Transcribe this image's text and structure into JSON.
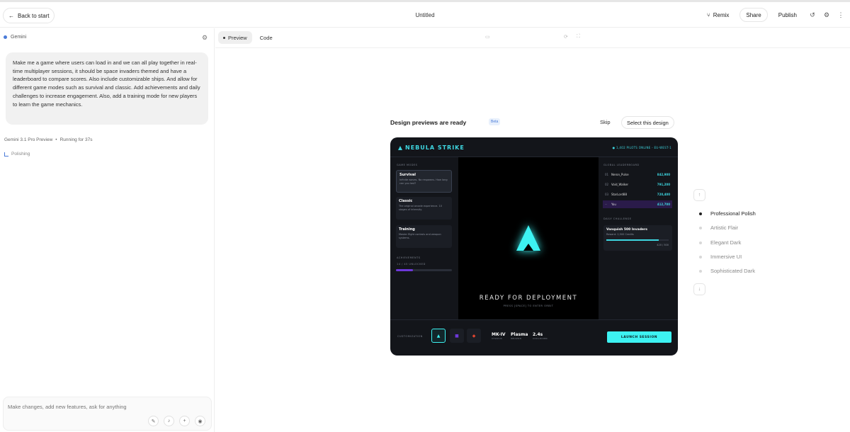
{
  "topbar": {
    "back_label": "Back to start",
    "title": "Untitled",
    "remix_label": "Remix",
    "share_label": "Share",
    "publish_label": "Publish"
  },
  "chat": {
    "model_label": "Gemini",
    "prompt": "Make me a game where users can load in and we can all play together in real-time multiplayer sessions, it should be space invaders themed and have a leaderboard to compare scores. Also include customizable ships. And allow for different game modes such as survival and classic. Add achievements and daily challenges to increase engagement. Also, add a training mode for new players to learn the game mechanics.",
    "model_name": "Gemini 3.1 Pro Preview",
    "separator": "•",
    "running": "Running for 37s",
    "polishing": "Polishing",
    "composer_placeholder": "Make changes, add new features, ask for anything"
  },
  "preview": {
    "tab_preview": "Preview",
    "tab_code": "Code",
    "ready_text": "Design previews are ready",
    "beta": "Beta",
    "skip": "Skip",
    "select": "Select this design"
  },
  "game": {
    "logo": "NEBULA STRIKE",
    "online": "● 1,402 PILOTS ONLINE - EU-WEST-1",
    "game_modes_label": "GAME MODES",
    "modes": [
      {
        "title": "Survival",
        "desc": "Infinite waves. No respawns. How long can you last?"
      },
      {
        "title": "Classic",
        "desc": "The original arcade experience. 10 stages of intensity."
      },
      {
        "title": "Training",
        "desc": "Master flight controls and weapon systems."
      }
    ],
    "achievements_label": "ACHIEVEMENTS",
    "achievements_count": "14 / 45 UNLOCKED",
    "achievements_progress": 0.31,
    "ready": "READY FOR DEPLOYMENT",
    "press": "PRESS [SPACE] TO ENTER ORBIT",
    "leaderboard_label": "GLOBAL LEADERBOARD",
    "leaderboard": [
      {
        "rank": "01",
        "name": "Neron_Pulse",
        "score": "842,900"
      },
      {
        "rank": "02",
        "name": "Void_Walker",
        "score": "791,200"
      },
      {
        "rank": "03",
        "name": "StarLord88",
        "score": "720,400"
      },
      {
        "rank": "--",
        "name": "You",
        "score": "412,700"
      }
    ],
    "daily_label": "DAILY CHALLENGE",
    "daily_title": "Vanquish 500 Invaders",
    "daily_desc": "Reward: 2,500 Credits",
    "daily_count": "420 / 500",
    "daily_progress": 0.84,
    "customization_label": "CUSTOMIZATION",
    "specs": [
      {
        "value": "MK-IV",
        "label": "CHASSIS"
      },
      {
        "value": "Plasma",
        "label": "WEAPON"
      },
      {
        "value": "2.4s",
        "label": "COOLDOWN"
      }
    ],
    "launch": "LAUNCH SESSION"
  },
  "styles": [
    {
      "label": "Professional Polish",
      "active": true
    },
    {
      "label": "Artistic Flair",
      "active": false
    },
    {
      "label": "Elegant Dark",
      "active": false
    },
    {
      "label": "Immersive UI",
      "active": false
    },
    {
      "label": "Sophisticated Dark",
      "active": false
    }
  ],
  "colors": {
    "accent": "#3df2f2",
    "purple": "#6d38d8",
    "game_bg": "#13151a"
  }
}
